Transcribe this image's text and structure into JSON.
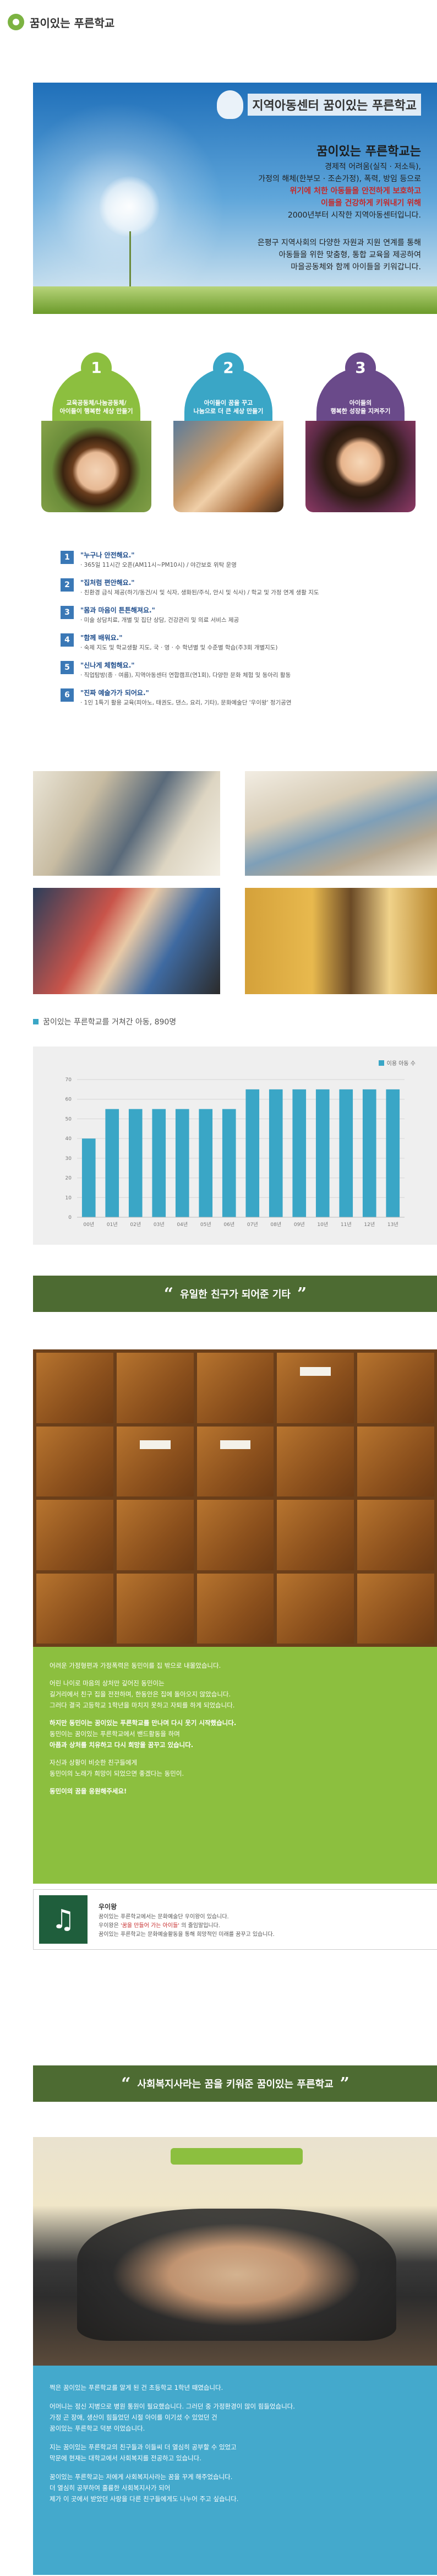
{
  "header": {
    "title": "꿈이있는 푸른학교"
  },
  "hero": {
    "brand_text": "지역아동센터 꿈이있는 푸른학교",
    "intro_title": "꿈이있는 푸른학교는",
    "intro_line1": "경제적 어려움(실직 · 저소득),",
    "intro_line2": "가정의 해체(한부모 · 조손가정), 폭력, 방임 등으로",
    "intro_line3": "위기에 처한 아동들을 안전하게 보호하고",
    "intro_line4": "이들을 건강하게 키워내기 위해",
    "intro_line5": "2000년부터 시작한 지역아동센터입니다.",
    "mission_line1": "은평구 지역사회의 다양한 자원과 지원 연계를 통해",
    "mission_line2": "아동들을 위한 맞춤형, 통합 교육을 제공하여",
    "mission_line3": "마을공동체와 함께 아이들을 키워갑니다."
  },
  "circles": [
    {
      "num": "1",
      "line1": "교육공동체/나눔공동체/",
      "line2": "아이들이 행복한 세상 만들기",
      "color": "#8cbf3f"
    },
    {
      "num": "2",
      "line1": "아이들이 꿈을 꾸고",
      "line2": "나눔으로 더 큰 세상 만들기",
      "color": "#3aa6c6"
    },
    {
      "num": "3",
      "line1": "아이들의",
      "line2": "행복한 성장을 지켜주기",
      "color": "#6a4a8a"
    }
  ],
  "list": [
    {
      "num": "1",
      "title": "\"누구나 안전해요.\"",
      "desc": "· 365일 11시간 오픈(AM11시~PM10시) / 야간보호 위탁 운영"
    },
    {
      "num": "2",
      "title": "\"집처럼 편안해요.\"",
      "desc": "· 친환경 급식 제공(하기/동건/시 및 식자, 생화된/주식, 안시 및 식사) / 학교 및 가정 연계 생활 지도"
    },
    {
      "num": "3",
      "title": "\"몸과 마음이 튼튼해져요.\"",
      "desc": "· 미술 상담치료, 개별 및 집단 상담, 건강관리 및 의료 서비스 제공"
    },
    {
      "num": "4",
      "title": "\"함께 배워요.\"",
      "desc": "· 숙제 지도 및 학교생활 지도, 국 · 영 · 수 학년별 및 수준별 학습(주3회 개별지도)"
    },
    {
      "num": "5",
      "title": "\"신나게 체험해요.\"",
      "desc": "· 직업탐방(종 · 여름), 지역아동센터 연합캠프(연1회), 다양한 문화 체험 및 동아리 활동"
    },
    {
      "num": "6",
      "title": "\"진짜 예술가가 되어요.\"",
      "desc": "· 1인 1특기 활용 교육(피아노, 태권도, 댄스, 요리, 기타), 문화예술단 '우이왕' 정기공연"
    }
  ],
  "chart_title": "꿈이있는 푸른학교를 거쳐간 아동, 890명",
  "chart_data": {
    "type": "bar",
    "title": "꿈이있는 푸른학교를 거쳐간 아동, 890명",
    "legend": "이용 아동 수",
    "categories": [
      "00년",
      "01년",
      "02년",
      "03년",
      "04년",
      "05년",
      "06년",
      "07년",
      "08년",
      "09년",
      "10년",
      "11년",
      "12년",
      "13년"
    ],
    "values": [
      40,
      55,
      55,
      55,
      55,
      55,
      55,
      65,
      65,
      65,
      65,
      65,
      65,
      65
    ],
    "ylim": [
      0,
      70
    ],
    "yticks": [
      0,
      10,
      20,
      30,
      40,
      50,
      60,
      70
    ],
    "color": "#3aa6c6",
    "grid": true
  },
  "section1": {
    "open_quote": "“",
    "title": "유일한 친구가 되어준 기타",
    "close_quote": "”"
  },
  "story1": {
    "p1": "어려운 가정형편과 가정폭력은 동민이를 집 밖으로 내몰았습니다.",
    "p2a": "어린 나이로 마음의 상처만 깊어진 동민이는",
    "p2b": "길거리에서 친구 집을 전전하며, 한동안은 집에 돌아오지 않았습니다.",
    "p2c": "그러다 결국 고등학교 1학년을 마치지 못하고 자퇴를 하게 되었습니다.",
    "p3a": "하지만 동민이는 꿈이있는 푸른학교를 만나며 다시 웃기 시작했습니다.",
    "p3b": "동민이는 꿈이있는 푸른학교에서 밴드활동을 하며",
    "p3c": "아픔과 상처를 치유하고 다시 희망을 꿈꾸고 있습니다.",
    "p4a": "자신과 상황이 비슷한 친구들에게",
    "p4b": "동민이의 노래가 희망이 되었으면 좋겠다는 동민이.",
    "p5": "동민이의 꿈을 응원해주세요!"
  },
  "card": {
    "icon": "music-note-icon",
    "title": "우이왕",
    "line1": "꿈이있는 푸른학교에서는 문화예술단 우이왕이 있습니다.",
    "line2_pre": "우이왕은 ",
    "line2_red": "'꿈을 만들어 가는 아이들'",
    "line2_post": " 의 줄임말입니다.",
    "line3": "꿈이있는 푸른학교는 문화예술활동을 통해 희망적인 미래를 꿈꾸고 있습니다."
  },
  "section2": {
    "open_quote": "“",
    "title": "사회복지사라는 꿈을 키워준 꿈이있는 푸른학교",
    "close_quote": "”"
  },
  "story2": {
    "p1": "쩍은 꿈이있는 푸른학교를 알게 된 건 초등학교 1학년 때였습니다.",
    "p2a": "어머니는 정신 지병으로 병원 통원이 필요했습니다. 그러던 중 가정환경이 많이 힘들었습니다.",
    "p2b": "가정 곤 장애, 생산이 힘들었던 시절 아이를 이기셨 수 있었던 건",
    "p2c": "꿈이있는 푸른학교 덕분 이었습니다.",
    "p3a": "지는 꿈이있는 푸른학교의 친구들과 이들씨 더 열심히 공부할 수 있었고",
    "p3b": "막문에 현재는 대학교에서 사회복지를 전공하고 있습니다.",
    "p4a": "꿈이있는 푸른학교는 저에게 사회복지사라는 꿈을 꾸게 해주었습니다.",
    "p4b": "더 열심히 공부하여 훌륭한 사회복지사가 되어",
    "p4c": "제가 이 곳에서 받았던 사랑을 다른 친구들에게도 나누어 주고 싶습니다."
  },
  "colors": {
    "green_accent": "#8cbf3f",
    "blue_accent": "#3aa6c6",
    "section_bar": "#4d6b32",
    "list_badge": "#3a78b6",
    "blue_panel": "#44a9cc"
  }
}
